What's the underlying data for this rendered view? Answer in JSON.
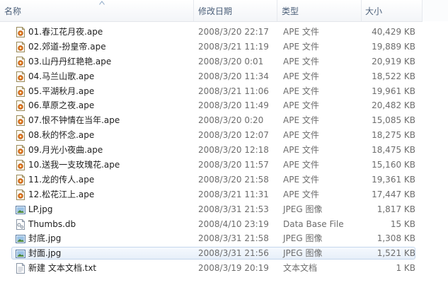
{
  "columns": {
    "name": "名称",
    "date": "修改日期",
    "type": "类型",
    "size": "大小"
  },
  "files": [
    {
      "name": "01.春江花月夜.ape",
      "date": "2008/3/20 22:17",
      "type": "APE 文件",
      "size": "40,429 KB",
      "icon": "ape-file-icon"
    },
    {
      "name": "02.郊道-扮皇帝.ape",
      "date": "2008/3/21 11:19",
      "type": "APE 文件",
      "size": "19,889 KB",
      "icon": "ape-file-icon"
    },
    {
      "name": "03.山丹丹红艳艳.ape",
      "date": "2008/3/20 0:01",
      "type": "APE 文件",
      "size": "20,919 KB",
      "icon": "ape-file-icon"
    },
    {
      "name": "04.马兰山歌.ape",
      "date": "2008/3/20 11:34",
      "type": "APE 文件",
      "size": "18,522 KB",
      "icon": "ape-file-icon"
    },
    {
      "name": "05.平湖秋月.ape",
      "date": "2008/3/21 11:06",
      "type": "APE 文件",
      "size": "19,961 KB",
      "icon": "ape-file-icon"
    },
    {
      "name": "06.草原之夜.ape",
      "date": "2008/3/20 11:49",
      "type": "APE 文件",
      "size": "20,482 KB",
      "icon": "ape-file-icon"
    },
    {
      "name": "07.恨不钟情在当年.ape",
      "date": "2008/3/20 0:20",
      "type": "APE 文件",
      "size": "15,085 KB",
      "icon": "ape-file-icon"
    },
    {
      "name": "08.秋的怀念.ape",
      "date": "2008/3/20 12:07",
      "type": "APE 文件",
      "size": "18,275 KB",
      "icon": "ape-file-icon"
    },
    {
      "name": "09.月光小夜曲.ape",
      "date": "2008/3/20 12:18",
      "type": "APE 文件",
      "size": "18,475 KB",
      "icon": "ape-file-icon"
    },
    {
      "name": "10.送我一支玫瑰花.ape",
      "date": "2008/3/20 11:57",
      "type": "APE 文件",
      "size": "15,160 KB",
      "icon": "ape-file-icon"
    },
    {
      "name": "11.龙的传人.ape",
      "date": "2008/3/20 21:58",
      "type": "APE 文件",
      "size": "19,361 KB",
      "icon": "ape-file-icon"
    },
    {
      "name": "12.松花江上.ape",
      "date": "2008/3/21 11:31",
      "type": "APE 文件",
      "size": "17,447 KB",
      "icon": "ape-file-icon"
    },
    {
      "name": "LP.jpg",
      "date": "2008/3/31 21:53",
      "type": "JPEG 图像",
      "size": "1,817 KB",
      "icon": "jpeg-image-icon"
    },
    {
      "name": "Thumbs.db",
      "date": "2008/4/10 23:19",
      "type": "Data Base File",
      "size": "15 KB",
      "icon": "database-file-icon"
    },
    {
      "name": "封底.jpg",
      "date": "2008/3/31 21:58",
      "type": "JPEG 图像",
      "size": "1,308 KB",
      "icon": "jpeg-image-icon"
    },
    {
      "name": "封面.jpg",
      "date": "2008/3/31 21:56",
      "type": "JPEG 图像",
      "size": "1,521 KB",
      "icon": "jpeg-image-icon",
      "selected": true
    },
    {
      "name": "新建 文本文档.txt",
      "date": "2008/3/19 20:19",
      "type": "文本文档",
      "size": "1 KB",
      "icon": "text-file-icon"
    }
  ],
  "colors": {
    "header_text": "#4c607a",
    "detail_text": "#6d6d6d",
    "selection_border": "#c4d6ec",
    "selection_fill": "#e7eff9"
  }
}
